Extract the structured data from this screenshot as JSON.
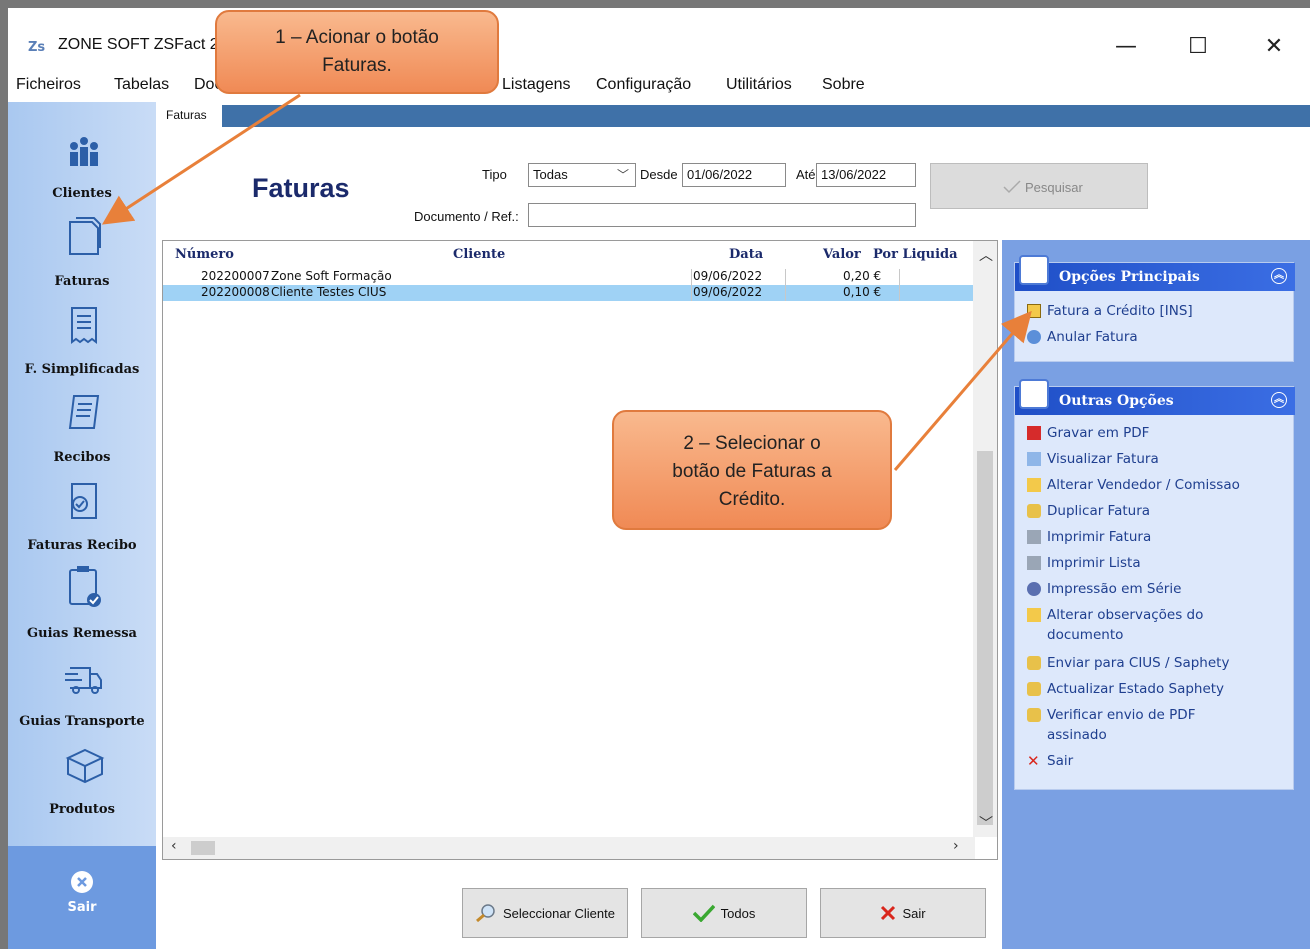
{
  "window": {
    "title": "ZONE SOFT ZSFact 2",
    "app_icon_text": "Zs",
    "minimize": "—",
    "maximize": "☐",
    "close": "✕"
  },
  "menu": [
    "Ficheiros",
    "Tabelas",
    "Doc",
    "Listagens",
    "Configuração",
    "Utilitários",
    "Sobre"
  ],
  "sidebar": {
    "items": [
      {
        "label": "Clientes"
      },
      {
        "label": "Faturas"
      },
      {
        "label": "F. Simplificadas"
      },
      {
        "label": "Recibos"
      },
      {
        "label": "Faturas Recibo"
      },
      {
        "label": "Guias Remessa"
      },
      {
        "label": "Guias Transporte"
      },
      {
        "label": "Produtos"
      }
    ],
    "exit_label": "Sair"
  },
  "tab": {
    "label": "Faturas"
  },
  "header": {
    "title": "Faturas",
    "tipo_label": "Tipo",
    "tipo_value": "Todas",
    "desde_label": "Desde",
    "desde_value": "01/06/2022",
    "ate_label": "Até",
    "ate_value": "13/06/2022",
    "doc_label": "Documento / Ref.:",
    "doc_value": "",
    "search_label": "Pesquisar"
  },
  "table": {
    "columns": [
      "Número",
      "Cliente",
      "Data",
      "Valor",
      "Por Liquida"
    ],
    "rows": [
      {
        "numero": "202200007",
        "cliente": "Zone Soft Formação",
        "data": "09/06/2022",
        "valor": "0,20 €"
      },
      {
        "numero": "202200008",
        "cliente": "Cliente Testes CIUS",
        "data": "09/06/2022",
        "valor": "0,10 €"
      }
    ]
  },
  "buttons": {
    "select_client": "Seleccionar Cliente",
    "all": "Todos",
    "exit": "Sair"
  },
  "panel": {
    "main_title": "Opções Principais",
    "main_options": [
      "Fatura a Crédito [INS]",
      "Anular Fatura"
    ],
    "other_title": "Outras Opções",
    "other_options": [
      "Gravar em PDF",
      "Visualizar Fatura",
      "Alterar Vendedor / Comissao",
      "Duplicar Fatura",
      "Imprimir Fatura",
      "Imprimir Lista",
      "Impressão em Série",
      "Alterar observações do",
      "documento",
      "Enviar para CIUS / Saphety",
      "Actualizar Estado Saphety",
      "Verificar envio de PDF",
      "assinado",
      "Sair"
    ]
  },
  "callouts": {
    "one": [
      "1 – Acionar o botão",
      "Faturas."
    ],
    "two": [
      "2 – Selecionar o",
      "botão de Faturas a",
      "Crédito."
    ]
  },
  "colors": {
    "accent": "#1f4fc7",
    "callout": "#f4a070",
    "arrow": "#e8803a",
    "selected_row": "#9fd2f5"
  }
}
